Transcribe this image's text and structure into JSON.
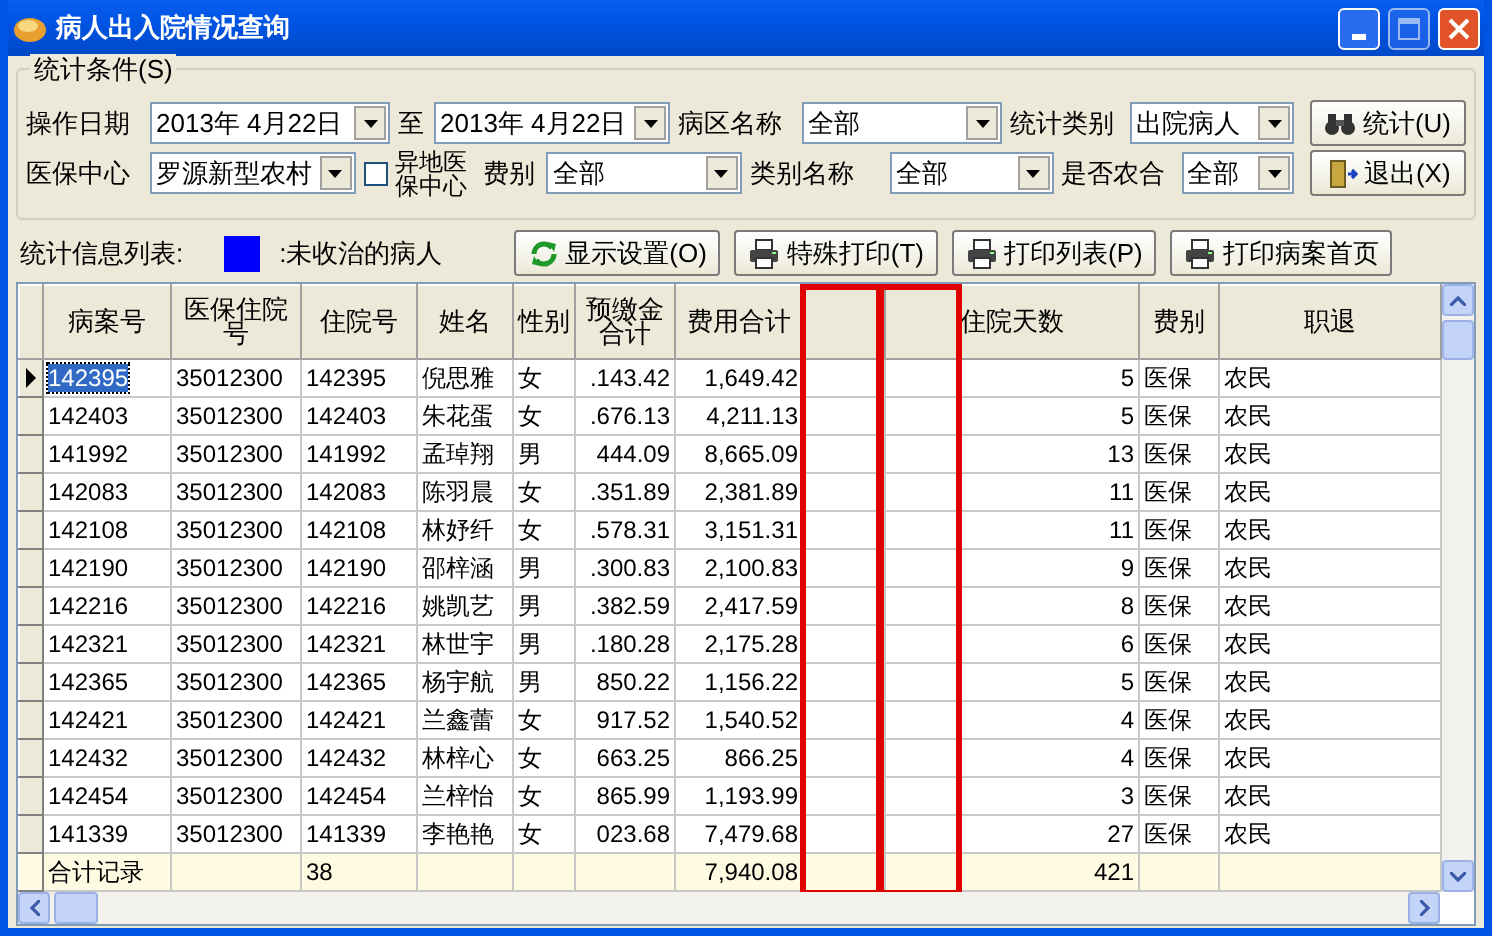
{
  "window": {
    "title": "病人出入院情况查询"
  },
  "filters": {
    "legend": "统计条件(S)",
    "row_1": [
      {
        "kind": "combo",
        "label": "操作日期",
        "value": "2013年  4月22日"
      },
      {
        "kind": "combo",
        "label": "至",
        "value": "2013年  4月22日"
      },
      {
        "kind": "combo",
        "label": "病区名称",
        "value": "全部"
      },
      {
        "kind": "combo",
        "label": "统计类别",
        "value": "出院病人"
      }
    ],
    "row_2": [
      {
        "kind": "combo",
        "label": "医保中心",
        "value": "罗源新型农村"
      },
      {
        "kind": "check",
        "label": "异地医保中心",
        "checked": false
      },
      {
        "kind": "combo",
        "label": "费别",
        "value": "全部"
      },
      {
        "kind": "combo",
        "label": "类别名称",
        "value": "全部"
      },
      {
        "kind": "combo",
        "label": "是否农合",
        "value": "全部"
      }
    ],
    "buttons": [
      {
        "kind": "search",
        "label": "统计(U)"
      },
      {
        "kind": "exit",
        "label": "退出(X)"
      }
    ]
  },
  "legend_row": {
    "label": "统计信息列表:",
    "color": "#0000ff",
    "meaning": ":未收治的病人"
  },
  "toolbar": [
    {
      "kind": "refresh",
      "label": "显示设置(O)"
    },
    {
      "kind": "print",
      "label": "特殊打印(T)"
    },
    {
      "kind": "print",
      "label": "打印列表(P)"
    },
    {
      "kind": "print",
      "label": "打印病案首页"
    }
  ],
  "table": {
    "columns": [
      "病案号",
      "医保住院号",
      "住院号",
      "姓名",
      "性别",
      "预缴金合计",
      "费用合计",
      null,
      "住院天数",
      "费别",
      "职退"
    ],
    "rows": [
      {
        "selected": true,
        "cells": [
          "142395",
          "35012300",
          "142395",
          "倪思雅",
          "女",
          ".143.42",
          "1,649.42",
          null,
          "5",
          "医保",
          "农民"
        ]
      },
      {
        "selected": false,
        "cells": [
          "142403",
          "35012300",
          "142403",
          "朱花蛋",
          "女",
          ".676.13",
          "4,211.13",
          null,
          "5",
          "医保",
          "农民"
        ]
      },
      {
        "selected": false,
        "cells": [
          "141992",
          "35012300",
          "141992",
          "孟琸翔",
          "男",
          "444.09",
          "8,665.09",
          null,
          "13",
          "医保",
          "农民"
        ]
      },
      {
        "selected": false,
        "cells": [
          "142083",
          "35012300",
          "142083",
          "陈羽晨",
          "女",
          ".351.89",
          "2,381.89",
          null,
          "11",
          "医保",
          "农民"
        ]
      },
      {
        "selected": false,
        "cells": [
          "142108",
          "35012300",
          "142108",
          "林妤纤",
          "女",
          ".578.31",
          "3,151.31",
          null,
          "11",
          "医保",
          "农民"
        ]
      },
      {
        "selected": false,
        "cells": [
          "142190",
          "35012300",
          "142190",
          "邵梓涵",
          "男",
          ".300.83",
          "2,100.83",
          null,
          "9",
          "医保",
          "农民"
        ]
      },
      {
        "selected": false,
        "cells": [
          "142216",
          "35012300",
          "142216",
          "姚凯艺",
          "男",
          ".382.59",
          "2,417.59",
          null,
          "8",
          "医保",
          "农民"
        ]
      },
      {
        "selected": false,
        "cells": [
          "142321",
          "35012300",
          "142321",
          "林世宇",
          "男",
          ".180.28",
          "2,175.28",
          null,
          "6",
          "医保",
          "农民"
        ]
      },
      {
        "selected": false,
        "cells": [
          "142365",
          "35012300",
          "142365",
          "杨宇航",
          "男",
          "850.22",
          "1,156.22",
          null,
          "5",
          "医保",
          "农民"
        ]
      },
      {
        "selected": false,
        "cells": [
          "142421",
          "35012300",
          "142421",
          "兰鑫蕾",
          "女",
          "917.52",
          "1,540.52",
          null,
          "4",
          "医保",
          "农民"
        ]
      },
      {
        "selected": false,
        "cells": [
          "142432",
          "35012300",
          "142432",
          "林梓心",
          "女",
          "663.25",
          "866.25",
          null,
          "4",
          "医保",
          "农民"
        ]
      },
      {
        "selected": false,
        "cells": [
          "142454",
          "35012300",
          "142454",
          "兰梓怡",
          "女",
          "865.99",
          "1,193.99",
          null,
          "3",
          "医保",
          "农民"
        ]
      },
      {
        "selected": false,
        "cells": [
          "141339",
          "35012300",
          "141339",
          "李艳艳",
          "女",
          "023.68",
          "7,479.68",
          null,
          "27",
          "医保",
          "农民"
        ]
      }
    ],
    "footer": {
      "label": "合计记录",
      "count": "38",
      "cost_total": "7,940.08",
      "days_total": "421"
    }
  },
  "annotations": [
    {
      "kind": "frame"
    },
    {
      "kind": "frame"
    }
  ]
}
